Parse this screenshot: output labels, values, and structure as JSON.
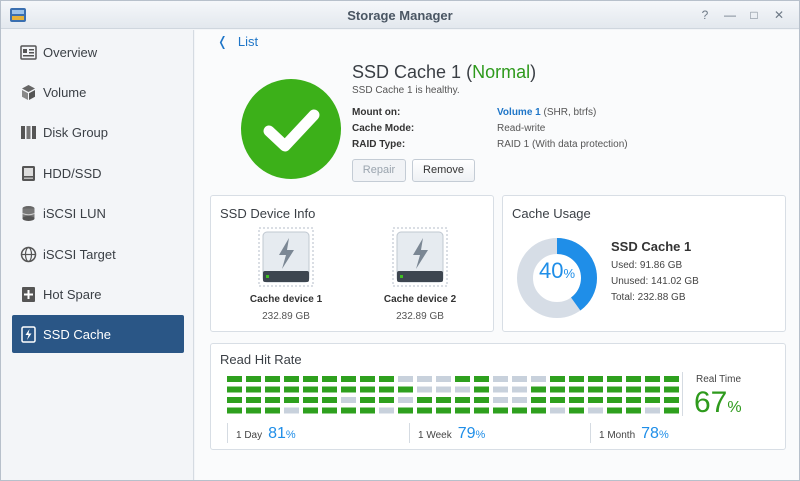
{
  "window": {
    "title": "Storage Manager"
  },
  "window_controls": {
    "help": "?",
    "minimize": "—",
    "maximize": "□",
    "close": "✕"
  },
  "sidebar": {
    "items": [
      {
        "label": "Overview",
        "icon": "overview-icon"
      },
      {
        "label": "Volume",
        "icon": "volume-icon"
      },
      {
        "label": "Disk Group",
        "icon": "disk-group-icon"
      },
      {
        "label": "HDD/SSD",
        "icon": "hdd-icon"
      },
      {
        "label": "iSCSI LUN",
        "icon": "iscsi-lun-icon"
      },
      {
        "label": "iSCSI Target",
        "icon": "iscsi-target-icon"
      },
      {
        "label": "Hot Spare",
        "icon": "hot-spare-icon"
      },
      {
        "label": "SSD Cache",
        "icon": "ssd-cache-icon",
        "active": true
      }
    ]
  },
  "header": {
    "back_label": "List",
    "back_icon": "chevron-left-icon"
  },
  "cache": {
    "name": "SSD Cache 1",
    "status": "Normal",
    "status_open": "(",
    "status_close": ")",
    "description": "SSD Cache 1 is healthy.",
    "mount_label": "Mount on:",
    "mount_volume": "Volume 1",
    "mount_detail": "(SHR, btrfs)",
    "mode_label": "Cache Mode:",
    "mode_value": "Read-write",
    "raid_label": "RAID Type:",
    "raid_value": "RAID 1 (With data protection)",
    "status_color": "#3cb019"
  },
  "actions": {
    "repair": "Repair",
    "remove": "Remove"
  },
  "device_info": {
    "title": "SSD Device Info",
    "devices": [
      {
        "name": "Cache device 1",
        "size": "232.89 GB"
      },
      {
        "name": "Cache device 2",
        "size": "232.89 GB"
      }
    ]
  },
  "usage": {
    "title": "Cache Usage",
    "percent": "40",
    "percent_sign": "%",
    "used_fraction": 0.4,
    "name": "SSD Cache 1",
    "used": "Used: 91.86 GB",
    "unused": "Unused: 141.02 GB",
    "total": "Total: 232.88 GB",
    "used_color": "#1f8ee8",
    "free_color": "#d6dde6"
  },
  "hit_rate": {
    "title": "Read Hit Rate",
    "realtime_label": "Real Time",
    "realtime_value": "67",
    "pct": "%",
    "day_label": "1 Day",
    "day_value": "81",
    "week_label": "1 Week",
    "week_value": "79",
    "month_label": "1 Month",
    "month_value": "78",
    "hit_color": "#2ea01e",
    "miss_color": "#c8d1dc",
    "grid": [
      "GGGGGGGGGMMMGGMMMGGGGGGG",
      "GGGGGGGGGGMMMGMMGGGGGGGG",
      "GGGGGGMGGMGGGGMMGGGGGGGG",
      "GGGMGGGGMGGGGGGGGMGMGGMG"
    ]
  }
}
